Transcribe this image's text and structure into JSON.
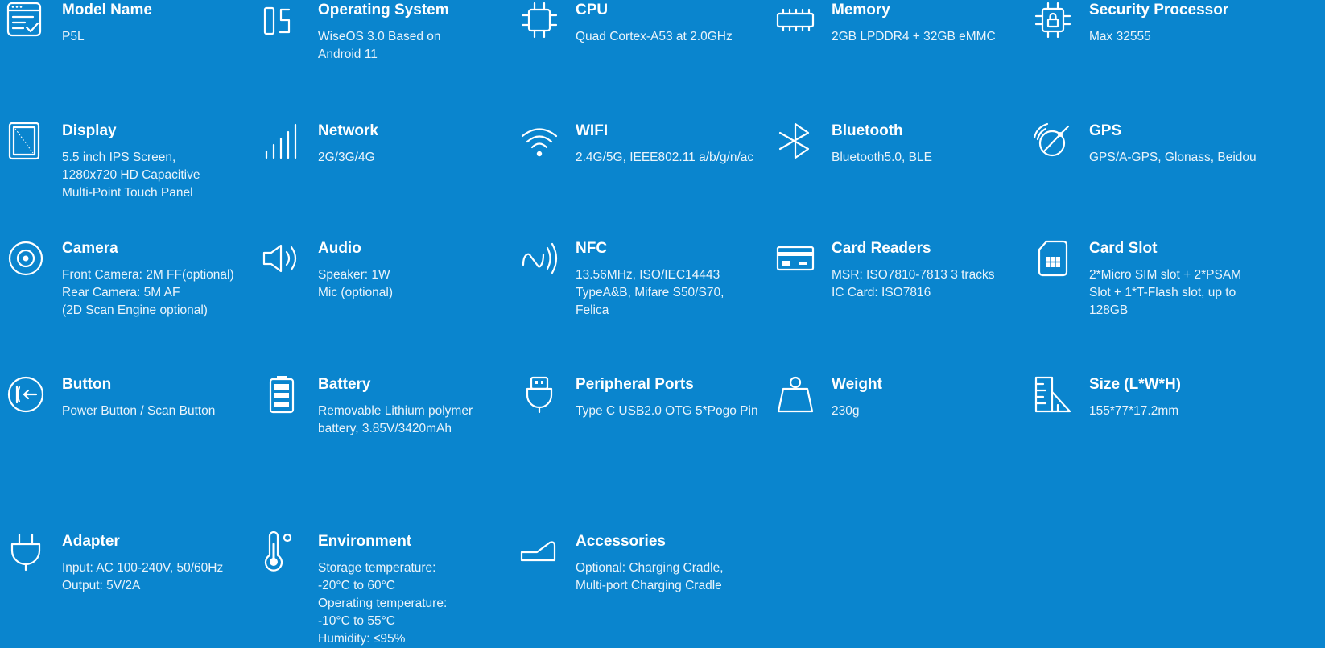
{
  "colors": {
    "background": "#0A85CE",
    "text": "#FFFFFF"
  },
  "specs": [
    {
      "icon": "model-name-icon",
      "title": "Model Name",
      "lines": [
        "P5L"
      ]
    },
    {
      "icon": "os-icon",
      "title": "Operating System",
      "lines": [
        "WiseOS 3.0 Based on",
        "Android 11"
      ]
    },
    {
      "icon": "cpu-chip-icon",
      "title": "CPU",
      "lines": [
        "Quad Cortex-A53 at 2.0GHz"
      ]
    },
    {
      "icon": "memory-icon",
      "title": "Memory",
      "lines": [
        "2GB LPDDR4 + 32GB eMMC"
      ]
    },
    {
      "icon": "security-chip-lock-icon",
      "title": "Security Processor",
      "lines": [
        "Max 32555"
      ]
    },
    {
      "icon": "display-tablet-icon",
      "title": "Display",
      "lines": [
        "5.5 inch IPS Screen,",
        "1280x720 HD Capacitive",
        "Multi-Point Touch Panel"
      ]
    },
    {
      "icon": "network-signal-icon",
      "title": "Network",
      "lines": [
        "2G/3G/4G"
      ]
    },
    {
      "icon": "wifi-icon",
      "title": "WIFI",
      "lines": [
        "2.4G/5G, IEEE802.11 a/b/g/n/ac"
      ]
    },
    {
      "icon": "bluetooth-icon",
      "title": "Bluetooth",
      "lines": [
        "Bluetooth5.0, BLE"
      ]
    },
    {
      "icon": "gps-satellite-icon",
      "title": "GPS",
      "lines": [
        "GPS/A-GPS, Glonass, Beidou"
      ]
    },
    {
      "icon": "camera-icon",
      "title": "Camera",
      "lines": [
        "Front Camera: 2M FF(optional)",
        "Rear Camera: 5M AF",
        "(2D Scan Engine optional)"
      ]
    },
    {
      "icon": "speaker-icon",
      "title": "Audio",
      "lines": [
        "Speaker: 1W",
        "Mic (optional)"
      ]
    },
    {
      "icon": "nfc-icon",
      "title": "NFC",
      "lines": [
        "13.56MHz, ISO/IEC14443",
        "TypeA&B, Mifare S50/S70,",
        "Felica"
      ]
    },
    {
      "icon": "card-reader-icon",
      "title": "Card Readers",
      "lines": [
        "MSR: ISO7810-7813 3 tracks",
        "IC Card: ISO7816"
      ]
    },
    {
      "icon": "sim-card-icon",
      "title": "Card Slot",
      "lines": [
        "2*Micro SIM slot + 2*PSAM",
        "Slot + 1*T-Flash slot, up to",
        "128GB"
      ]
    },
    {
      "icon": "power-button-icon",
      "title": "Button",
      "lines": [
        "Power Button / Scan Button"
      ]
    },
    {
      "icon": "battery-icon",
      "title": "Battery",
      "lines": [
        "Removable Lithium polymer",
        "battery, 3.85V/3420mAh"
      ]
    },
    {
      "icon": "usb-port-icon",
      "title": "Peripheral Ports",
      "lines": [
        "Type C USB2.0 OTG 5*Pogo Pin"
      ]
    },
    {
      "icon": "weight-icon",
      "title": "Weight",
      "lines": [
        "230g"
      ]
    },
    {
      "icon": "size-ruler-icon",
      "title": "Size (L*W*H)",
      "lines": [
        "155*77*17.2mm"
      ]
    },
    {
      "icon": "power-plug-icon",
      "title": "Adapter",
      "lines": [
        "Input: AC 100-240V, 50/60Hz",
        "Output: 5V/2A"
      ]
    },
    {
      "icon": "thermometer-icon",
      "title": "Environment",
      "lines": [
        "Storage temperature:",
        "-20°C to 60°C",
        "Operating temperature:",
        "-10°C to 55°C",
        "Humidity: ≤95%"
      ]
    },
    {
      "icon": "cradle-icon",
      "title": "Accessories",
      "lines": [
        "Optional: Charging Cradle,",
        "Multi-port Charging Cradle"
      ]
    }
  ]
}
